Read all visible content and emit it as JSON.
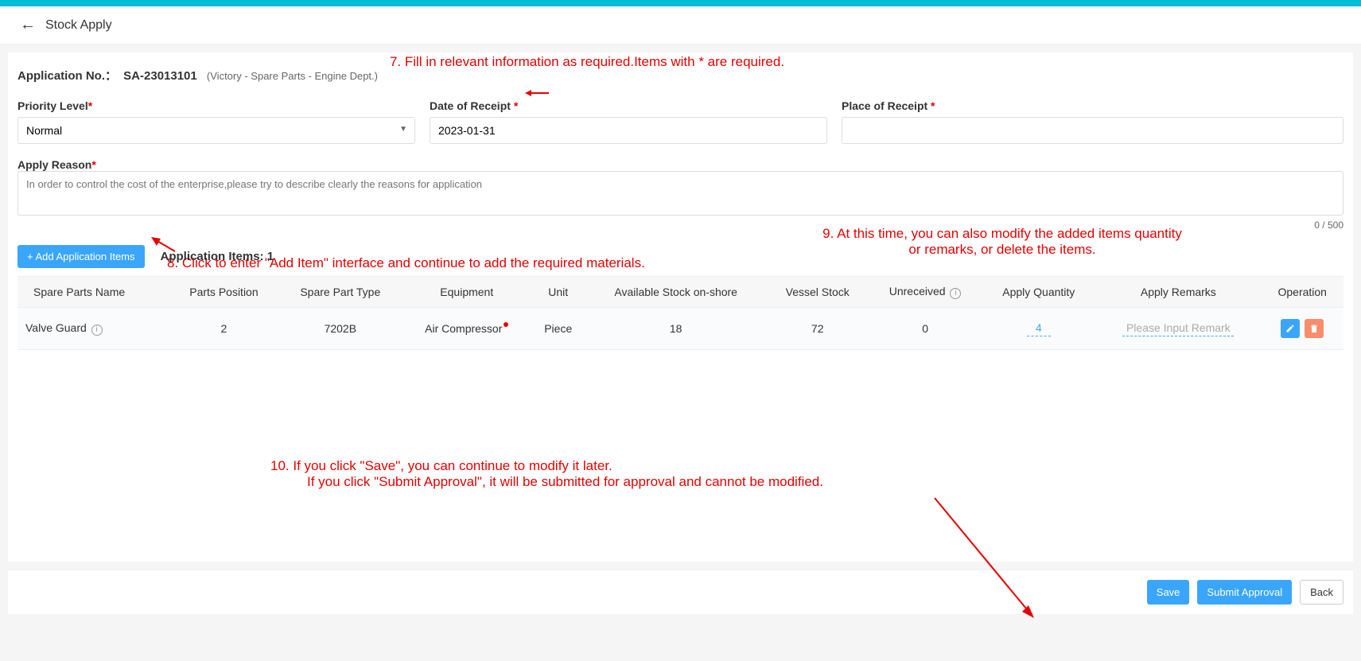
{
  "header": {
    "title": "Stock Apply"
  },
  "application": {
    "no_label": "Application No.：",
    "no_value": "SA-23013101",
    "context": "(Victory - Spare Parts - Engine Dept.)"
  },
  "form": {
    "priority": {
      "label": "Priority Level",
      "value": "Normal"
    },
    "date_receipt": {
      "label": "Date of Receipt",
      "value": "2023-01-31"
    },
    "place_receipt": {
      "label": "Place of Receipt",
      "value": ""
    },
    "apply_reason": {
      "label": "Apply Reason",
      "placeholder": "In order to control the cost of the enterprise,please try to describe clearly the reasons for application",
      "count": "0 / 500"
    }
  },
  "items_section": {
    "add_btn": "+ Add Application Items",
    "count_label": "Application Items:",
    "count_value": "1",
    "headers": {
      "spare_name": "Spare Parts Name",
      "position": "Parts Position",
      "type": "Spare Part Type",
      "equipment": "Equipment",
      "unit": "Unit",
      "avail_shore": "Available Stock on-shore",
      "vessel_stock": "Vessel Stock",
      "unreceived": "Unreceived",
      "apply_qty": "Apply Quantity",
      "apply_remarks": "Apply Remarks",
      "operation": "Operation"
    },
    "rows": [
      {
        "spare_name": "Valve Guard",
        "position": "2",
        "type": "7202B",
        "equipment": "Air Compressor",
        "unit": "Piece",
        "avail_shore": "18",
        "vessel_stock": "72",
        "unreceived": "0",
        "apply_qty": "4",
        "apply_remarks_ph": "Please Input Remark"
      }
    ]
  },
  "annotations": {
    "step7": "7. Fill in relevant information as required.Items with * are required.",
    "step8": "8. Click to enter \"Add Item\" interface and continue to add the required materials.",
    "step9": "9. At this time, you can also modify the added items quantity or remarks, or delete the items.",
    "step10_l1": "10. If you click \"Save\", you can continue to modify it later.",
    "step10_l2": "If you click \"Submit Approval\", it will be submitted for approval and cannot be modified."
  },
  "footer": {
    "save": "Save",
    "submit": "Submit Approval",
    "back": "Back"
  }
}
